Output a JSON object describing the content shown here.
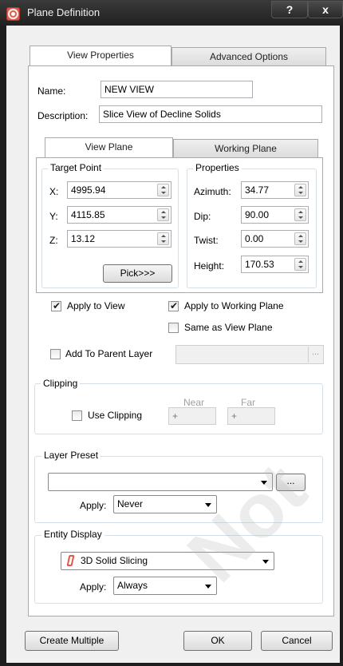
{
  "window": {
    "title": "Plane Definition",
    "help_label": "?",
    "close_label": "x"
  },
  "tabs": {
    "view_properties": "View Properties",
    "advanced_options": "Advanced Options"
  },
  "name_field": {
    "label": "Name:",
    "value": "NEW VIEW"
  },
  "description_field": {
    "label": "Description:",
    "value": "Slice View of Decline Solids"
  },
  "inner_tabs": {
    "view_plane": "View Plane",
    "working_plane": "Working Plane"
  },
  "target_point": {
    "title": "Target Point",
    "x": {
      "label": "X:",
      "value": "4995.94"
    },
    "y": {
      "label": "Y:",
      "value": "4115.85"
    },
    "z": {
      "label": "Z:",
      "value": "13.12"
    },
    "pick_label": "Pick>>>"
  },
  "properties": {
    "title": "Properties",
    "azimuth": {
      "label": "Azimuth:",
      "value": "34.77"
    },
    "dip": {
      "label": "Dip:",
      "value": "90.00"
    },
    "twist": {
      "label": "Twist:",
      "value": "0.00"
    },
    "height": {
      "label": "Height:",
      "value": "170.53"
    }
  },
  "options": {
    "apply_to_view": {
      "label": "Apply to View",
      "checked": true
    },
    "apply_to_working_plane": {
      "label": "Apply to Working Plane",
      "checked": true
    },
    "same_as_view_plane": {
      "label": "Same as View Plane",
      "checked": false
    },
    "add_to_parent_layer": {
      "label": "Add To Parent Layer",
      "checked": false
    },
    "parent_layer_browse": "..."
  },
  "clipping": {
    "title": "Clipping",
    "use_clipping": {
      "label": "Use Clipping",
      "checked": false
    },
    "near_label": "Near",
    "far_label": "Far",
    "near_value": "+",
    "far_value": "+"
  },
  "layer_preset": {
    "title": "Layer Preset",
    "selected": "",
    "browse_label": "...",
    "apply_label": "Apply:",
    "apply_value": "Never"
  },
  "entity_display": {
    "title": "Entity Display",
    "selected": "3D Solid Slicing",
    "apply_label": "Apply:",
    "apply_value": "Always"
  },
  "footer": {
    "create_multiple": "Create Multiple",
    "ok": "OK",
    "cancel": "Cancel"
  },
  "watermark": {
    "text": "Not"
  },
  "colors": {
    "accent_icon": "#e0574a",
    "title_bar": "#2a2a2a"
  },
  "icons": [
    "app-icon",
    "help-icon",
    "close-icon",
    "slicing-icon",
    "dropdown-arrow-icon",
    "spin-icon",
    "checkmark-icon"
  ]
}
